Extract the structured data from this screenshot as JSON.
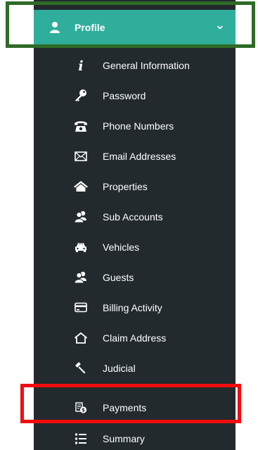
{
  "header": {
    "title": "Profile",
    "icon": "user-icon",
    "chevron": "chevron-down-icon",
    "accent_color": "#2fae9c"
  },
  "sidebar": {
    "background_color": "#222a2e",
    "items": [
      {
        "label": "General Information",
        "icon": "info-icon"
      },
      {
        "label": "Password",
        "icon": "key-icon"
      },
      {
        "label": "Phone Numbers",
        "icon": "phone-icon"
      },
      {
        "label": "Email Addresses",
        "icon": "envelope-icon"
      },
      {
        "label": "Properties",
        "icon": "house-icon"
      },
      {
        "label": "Sub Accounts",
        "icon": "users-icon"
      },
      {
        "label": "Vehicles",
        "icon": "car-icon"
      },
      {
        "label": "Guests",
        "icon": "guests-icon"
      },
      {
        "label": "Billing Activity",
        "icon": "credit-card-icon"
      },
      {
        "label": "Claim Address",
        "icon": "house-outline-icon"
      },
      {
        "label": "Judicial",
        "icon": "gavel-icon"
      },
      {
        "label": "Payments",
        "icon": "payments-icon"
      },
      {
        "label": "Summary",
        "icon": "list-icon"
      }
    ]
  },
  "highlights": {
    "header_border_color": "#2f6b26",
    "payments_border_color": "#f20d0d"
  }
}
